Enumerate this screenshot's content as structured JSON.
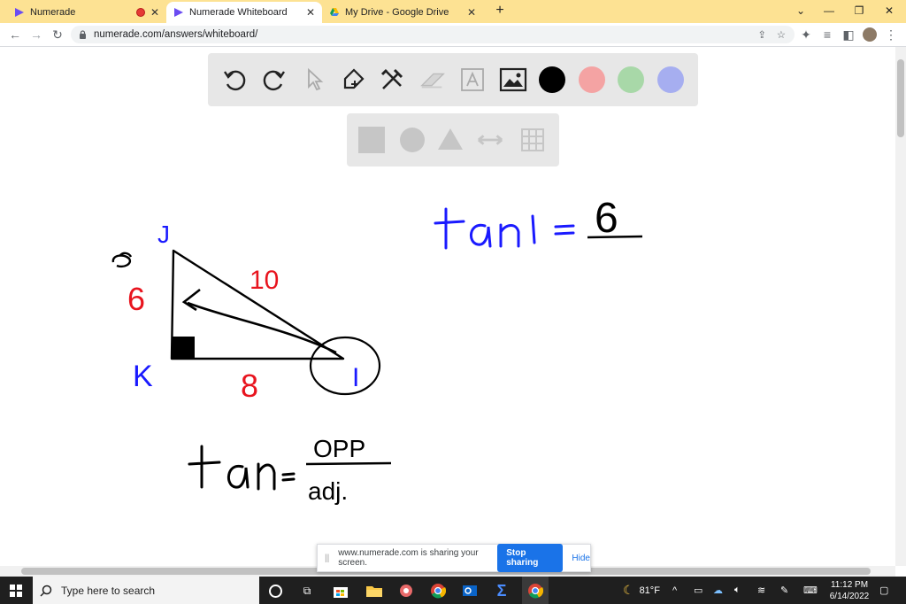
{
  "browser": {
    "tabs": [
      {
        "title": "Numerade",
        "recording": true
      },
      {
        "title": "Numerade Whiteboard",
        "active": true
      },
      {
        "title": "My Drive - Google Drive"
      }
    ],
    "url": "numerade.com/answers/whiteboard/"
  },
  "whiteboard": {
    "colors": {
      "black": "#000000",
      "red": "#f4a3a3",
      "green": "#a8d8a8",
      "blue": "#a6aef0"
    },
    "ink_blue": "#1a1aff",
    "ink_red": "#e8141e",
    "labels": {
      "j": "J",
      "k": "K",
      "i": "I",
      "hyp": "10",
      "leg_kj": "6",
      "leg_ki": "8",
      "tan_rhs_num": "6",
      "opp": "OPP",
      "adj": "adj."
    }
  },
  "sharebar": {
    "message": "www.numerade.com is sharing your screen.",
    "stop_label": "Stop sharing",
    "hide_label": "Hide"
  },
  "taskbar": {
    "search_placeholder": "Type here to search",
    "weather": "81°F",
    "time": "11:12 PM",
    "date": "6/14/2022"
  }
}
